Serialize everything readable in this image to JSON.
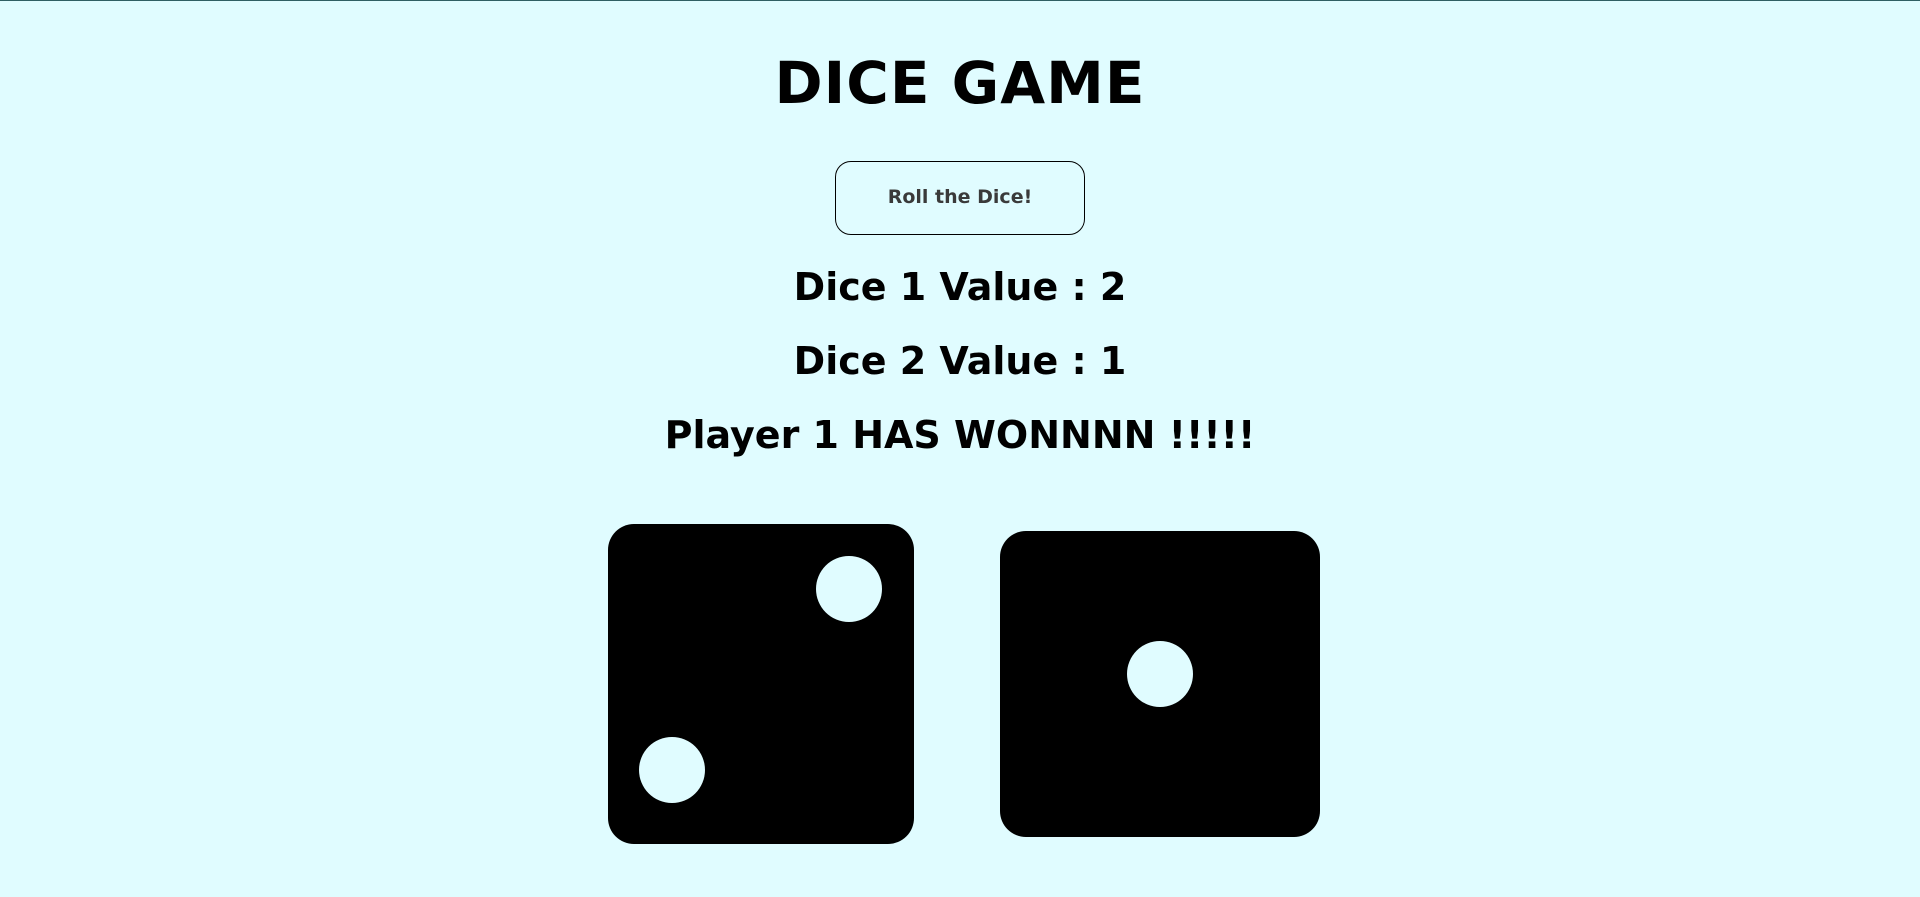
{
  "game": {
    "title": "DICE GAME",
    "roll_button_label": "Roll the Dice!"
  },
  "status": {
    "dice1_text": "Dice 1 Value : 2",
    "dice2_text": "Dice 2 Value : 1",
    "winner_text": "Player 1 HAS WONNNN !!!!!"
  },
  "dice": [
    {
      "name": "Dice 1",
      "value": 2,
      "face_icon": "dice-two-icon"
    },
    {
      "name": "Dice 2",
      "value": 1,
      "face_icon": "dice-one-icon"
    }
  ],
  "colors": {
    "background": "#e0fcff",
    "die_body": "#000000",
    "pip": "#e0fcff"
  }
}
